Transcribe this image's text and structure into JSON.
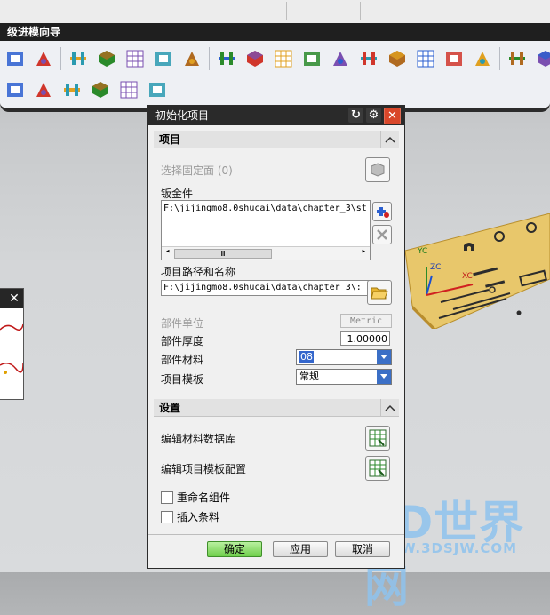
{
  "wizard": {
    "title": "级进模向导",
    "row1_icons": [
      "sm-tool-icon",
      "document-icon",
      "project-init-icon",
      "strip-icon",
      "layout-icon",
      "blank-icon",
      "die-base-icon",
      "wizard-icon",
      "notes-icon",
      "insert-icon",
      "plus-icon",
      "cube-icon",
      "diagram-icon",
      "block-icon",
      "cavity-icon",
      "stripes-icon",
      "tool-icon",
      "grid-icon",
      "frame-icon"
    ],
    "row2_icons": [
      "view-icon",
      "process-icon",
      "flow-icon",
      "edit-icon",
      "hammer-icon",
      "nx-tool-icon"
    ]
  },
  "dialog": {
    "title": "初始化项目",
    "group_project": "项目",
    "select_fixed_face": "选择固定面 (0)",
    "sheet_metal_label": "钣金件",
    "sheet_metal_path": "F:\\jijingmo8.0shucai\\data\\chapter_3\\st",
    "scroll_thumb": "Ⅲ",
    "project_path_label": "项目路径和名称",
    "project_path": "F:\\jijingmo8.0shucai\\data\\chapter_3\\:",
    "part_unit_label": "部件单位",
    "part_unit_value": "Metric",
    "thickness_label": "部件厚度",
    "thickness_value": "1.00000",
    "material_label": "部件材料",
    "material_value": "08",
    "template_label": "项目模板",
    "template_value": "常规",
    "group_settings": "设置",
    "edit_material_db": "编辑材料数据库",
    "edit_template_config": "编辑项目模板配置",
    "rename_components": "重命名组件",
    "insert_strip": "插入条料",
    "ok_label": "确定",
    "apply_label": "应用",
    "cancel_label": "取消"
  },
  "viewport": {
    "axis_yc": "YC",
    "axis_zc": "ZC",
    "axis_xc": "XC"
  },
  "watermark": {
    "brand": "3D世界网",
    "url": "WWW.3DSJW.COM"
  },
  "colors": {
    "part_fill": "#e8c76b",
    "title_bar": "#2a2a2a",
    "close_red": "#d9472a",
    "ok_green": "#6fcf4b",
    "combo_blue": "#3b6fc6"
  }
}
